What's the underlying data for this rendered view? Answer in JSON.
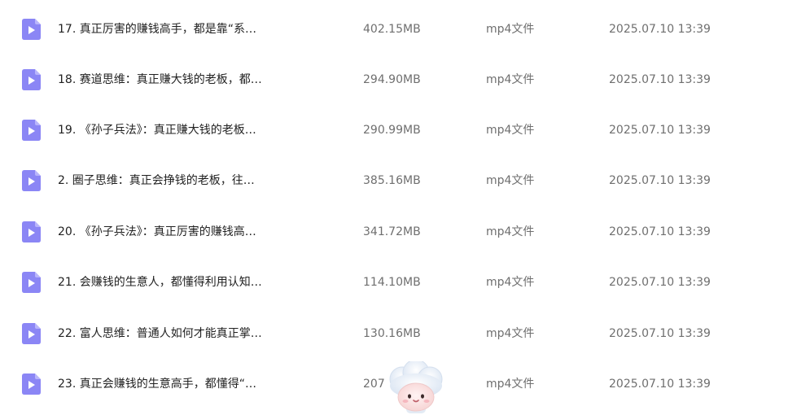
{
  "file_list": {
    "rows": [
      {
        "icon": "video-file-icon",
        "name": "17. 真正厉害的赚钱高手，都是靠“系…",
        "size": "402.15MB",
        "type": "mp4文件",
        "date": "2025.07.10 13:39"
      },
      {
        "icon": "video-file-icon",
        "name": "18. 赛道思维：真正赚大钱的老板，都…",
        "size": "294.90MB",
        "type": "mp4文件",
        "date": "2025.07.10 13:39"
      },
      {
        "icon": "video-file-icon",
        "name": "19. 《孙子兵法》：真正赚大钱的老板…",
        "size": "290.99MB",
        "type": "mp4文件",
        "date": "2025.07.10 13:39"
      },
      {
        "icon": "video-file-icon",
        "name": "2. 圈子思维：真正会挣钱的老板，往…",
        "size": "385.16MB",
        "type": "mp4文件",
        "date": "2025.07.10 13:39"
      },
      {
        "icon": "video-file-icon",
        "name": "20. 《孙子兵法》：真正厉害的赚钱高…",
        "size": "341.72MB",
        "type": "mp4文件",
        "date": "2025.07.10 13:39"
      },
      {
        "icon": "video-file-icon",
        "name": "21. 会赚钱的生意人，都懂得利用认知…",
        "size": "114.10MB",
        "type": "mp4文件",
        "date": "2025.07.10 13:39"
      },
      {
        "icon": "video-file-icon",
        "name": "22. 富人思维：普通人如何才能真正掌…",
        "size": "130.16MB",
        "type": "mp4文件",
        "date": "2025.07.10 13:39"
      },
      {
        "icon": "video-file-icon",
        "name": "23. 真正会赚钱的生意高手，都懂得“…",
        "size": "207",
        "type": "mp4文件",
        "date": "2025.07.10 13:39"
      }
    ]
  },
  "mascot": {
    "icon": "assistant-mascot-icon"
  },
  "colors": {
    "icon_fill": "#8b86f5",
    "icon_fold": "#b9b5fb",
    "name_text": "#222222",
    "meta_text": "#6f6f6f"
  }
}
